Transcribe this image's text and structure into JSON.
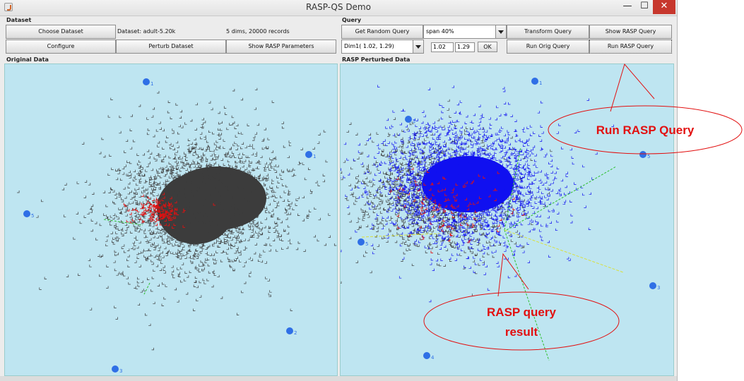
{
  "window": {
    "title": "RASP-QS Demo",
    "min_glyph": "—",
    "max_glyph": "☐",
    "close_glyph": "✕"
  },
  "dataset": {
    "section_label": "Dataset",
    "choose_button": "Choose Dataset",
    "dataset_info": "Dataset: adult-5.20k",
    "records_info": "5 dims, 20000 records",
    "configure_button": "Configure",
    "perturb_button": "Perturb Dataset",
    "show_params_button": "Show RASP Parameters"
  },
  "query": {
    "section_label": "Query",
    "random_button": "Get Random Query",
    "span_value": "span 40%",
    "dim_value": "Dim1( 1.02, 1.29)",
    "low_value": "1.02",
    "high_value": "1.29",
    "ok_button": "OK",
    "transform_button": "Transform Query",
    "show_rasp_query_button": "Show RASP Query",
    "run_orig_button": "Run Orig Query",
    "run_rasp_button": "Run RASP Query"
  },
  "original_panel": {
    "label": "Original Data",
    "anchors": [
      {
        "text": "1"
      },
      {
        "text": "1"
      },
      {
        "text": "5"
      },
      {
        "text": "2"
      },
      {
        "text": "3"
      }
    ]
  },
  "perturbed_panel": {
    "label": "RASP Perturbed Data",
    "anchors": [
      {
        "text": "1"
      },
      {
        "text": "2"
      },
      {
        "text": "5"
      },
      {
        "text": "3"
      },
      {
        "text": "4"
      },
      {
        "text": "5"
      }
    ]
  },
  "callouts": {
    "run_rasp_query": {
      "line1": "Run RASP Query"
    },
    "rasp_query_result": {
      "line1": "RASP query",
      "line2": "result"
    }
  },
  "colors": {
    "plot_bg": "#bee5f1",
    "points_gray": "#3c3c3c",
    "points_red": "#e01010",
    "points_blue": "#1010f0",
    "anchor_blue": "#2f6fe6",
    "callout_red": "#e21010"
  }
}
